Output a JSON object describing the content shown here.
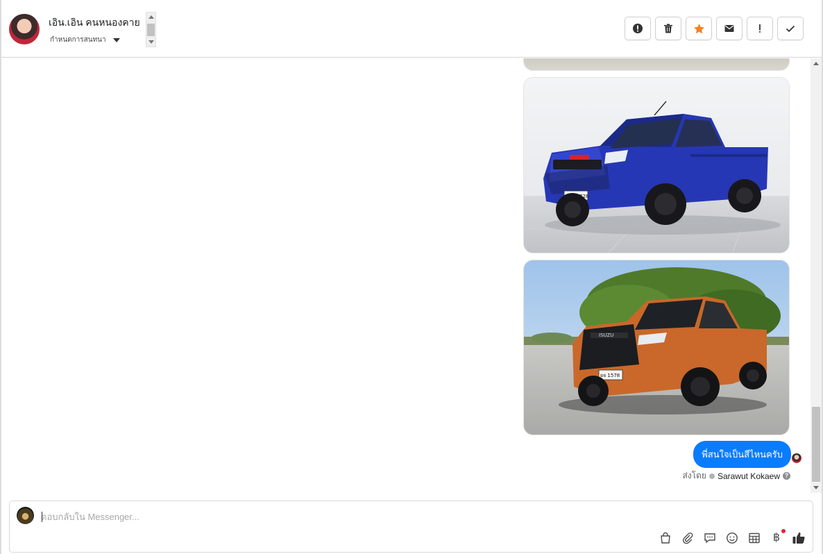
{
  "header": {
    "contact_name": "เอิน.เอิน คนหนองคาย",
    "assign_label": "กำหนดการสนทนา"
  },
  "toolbar": {
    "buttons": [
      {
        "name": "mark-spam",
        "icon": "exclamation-circle-icon"
      },
      {
        "name": "delete",
        "icon": "trash-icon"
      },
      {
        "name": "star",
        "icon": "star-icon",
        "color": "#f5821f"
      },
      {
        "name": "mark-unread",
        "icon": "envelope-icon"
      },
      {
        "name": "follow-up",
        "icon": "exclamation-icon"
      },
      {
        "name": "mark-done",
        "icon": "checkmark-icon"
      }
    ]
  },
  "messages": {
    "images": [
      {
        "name": "truck-image-top",
        "description_color": "#c8c4bb"
      },
      {
        "name": "truck-image-blue",
        "description_color": "#2c3fbf"
      },
      {
        "name": "truck-image-orange",
        "description_color": "#d9702a"
      }
    ],
    "bubble_text": "พี่สนใจเป็นสีไหนครับ",
    "bubble_color": "#0a7cff",
    "sent_by_prefix": "ส่งโดย",
    "sent_by_name": "Sarawut Kokaew"
  },
  "composer": {
    "placeholder": "ตอบกลับใน Messenger...",
    "tools": [
      "bag-icon",
      "paperclip-icon",
      "chat-bubble-icon",
      "emoji-icon",
      "table-icon",
      "baht-icon",
      "thumbs-up-icon"
    ],
    "baht_symbol": "฿"
  }
}
